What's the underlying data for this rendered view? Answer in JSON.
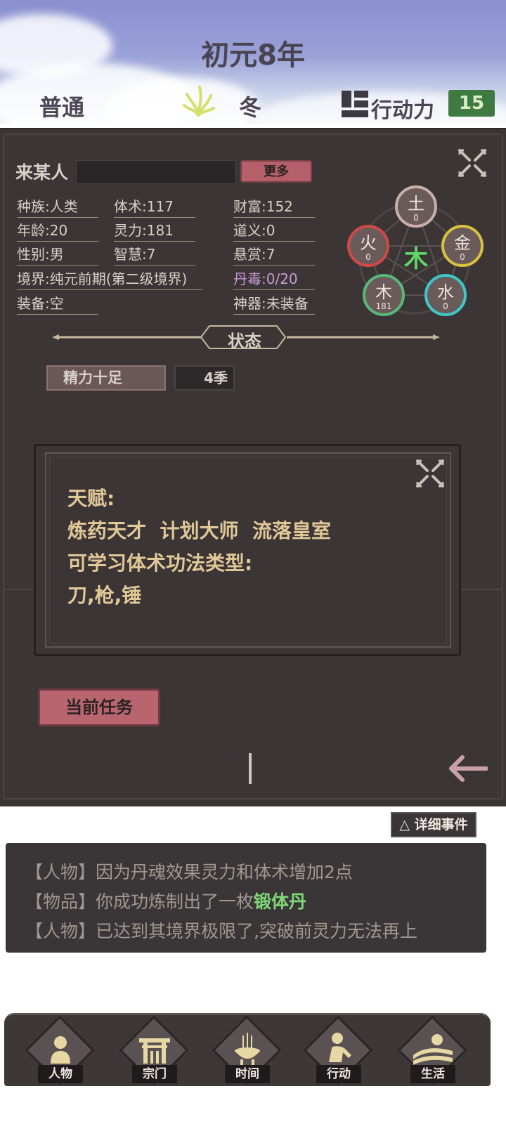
{
  "header": {
    "year_title": "初元8年",
    "difficulty": "普通",
    "season": "冬",
    "action_points_label": "行动力",
    "action_points_value": "15"
  },
  "character": {
    "name": "来某人",
    "more_button": "更多",
    "stats": {
      "race": "种族:人类",
      "body": "体术:117",
      "wealth": "财富:152",
      "age": "年龄:20",
      "spirit": "灵力:181",
      "righteousness": "道义:0",
      "gender": "性别:男",
      "wisdom": "智慧:7",
      "bounty": "悬赏:7",
      "realm": "境界:纯元前期(第二级境界)",
      "pill_toxicity": "丹毒:0/20",
      "equipment": "装备:空",
      "artifact": "神器:未装备"
    }
  },
  "wuxing": {
    "center": "木",
    "elements": [
      {
        "name": "土",
        "value": "0",
        "color": "#c8b0a8"
      },
      {
        "name": "金",
        "value": "0",
        "color": "#d8c040"
      },
      {
        "name": "水",
        "value": "0",
        "color": "#40c8c8"
      },
      {
        "name": "木",
        "value": "181",
        "color": "#58b878"
      },
      {
        "name": "火",
        "value": "0",
        "color": "#d04848"
      }
    ]
  },
  "status": {
    "title": "状态",
    "effect": "精力十足",
    "duration": "4季"
  },
  "talent_popup": {
    "label_talent": "天赋:",
    "talents": "炼药天才  计划大师  流落皇室",
    "label_martial": "可学习体术功法类型:",
    "martial_types": "刀,枪,锤"
  },
  "current_task_button": "当前任务",
  "log": {
    "detail_button": "△ 详细事件",
    "lines": [
      {
        "prefix": "【人物】",
        "text": "因为丹魂效果灵力和体术增加2点",
        "highlight": ""
      },
      {
        "prefix": "【物品】",
        "text": "你成功炼制出了一枚",
        "highlight": "锻体丹"
      },
      {
        "prefix": "【人物】",
        "text": "已达到其境界极限了,突破前灵力无法再上",
        "highlight": ""
      }
    ]
  },
  "nav": [
    {
      "label": "人物",
      "icon": "person-icon"
    },
    {
      "label": "宗门",
      "icon": "sect-gate-icon"
    },
    {
      "label": "时间",
      "icon": "incense-burner-icon"
    },
    {
      "label": "行动",
      "icon": "action-icon"
    },
    {
      "label": "生活",
      "icon": "landscape-icon"
    }
  ]
}
